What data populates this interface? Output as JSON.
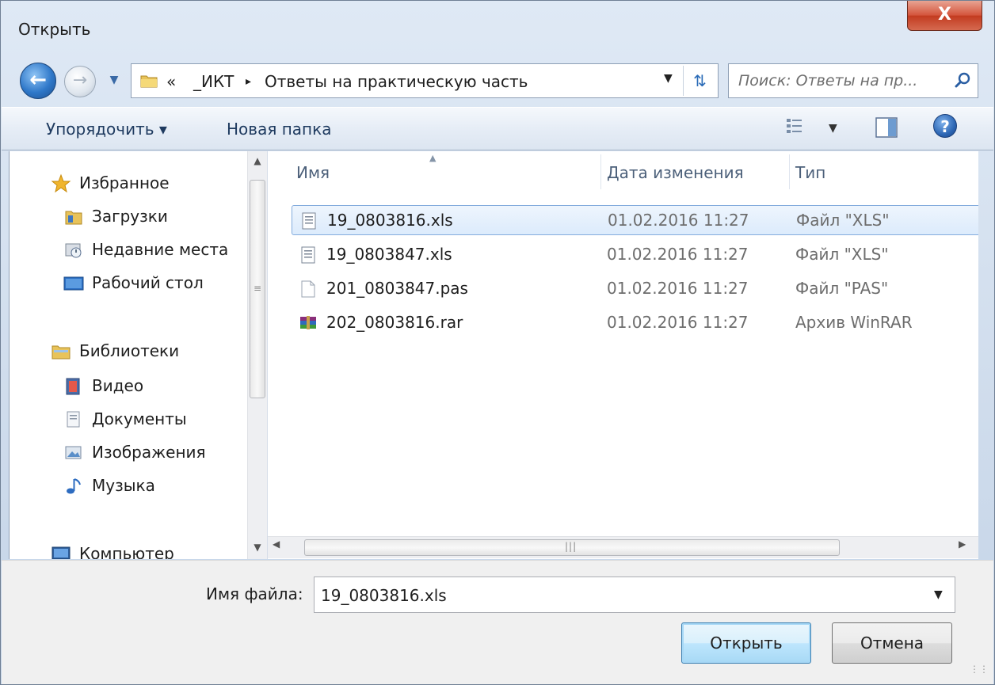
{
  "window": {
    "title": "Открыть",
    "close_label": "X"
  },
  "navigation": {
    "breadcrumb": [
      "«",
      "_ИКТ",
      "▸",
      "Ответы на практическую часть"
    ],
    "search_placeholder": "Поиск: Ответы на пр..."
  },
  "toolbar": {
    "organize_label": "Упорядочить ▾",
    "new_folder_label": "Новая папка"
  },
  "nav_pane": {
    "items": [
      {
        "label": "Избранное",
        "icon": "star-icon"
      },
      {
        "label": "Загрузки",
        "icon": "downloads-folder-icon"
      },
      {
        "label": "Недавние места",
        "icon": "recent-places-icon"
      },
      {
        "label": "Рабочий стол",
        "icon": "desktop-icon"
      },
      {
        "label": "Библиотеки",
        "icon": "libraries-icon"
      },
      {
        "label": "Видео",
        "icon": "video-icon"
      },
      {
        "label": "Документы",
        "icon": "documents-icon"
      },
      {
        "label": "Изображения",
        "icon": "pictures-icon"
      },
      {
        "label": "Музыка",
        "icon": "music-icon"
      },
      {
        "label": "Компьютер",
        "icon": "computer-icon"
      }
    ]
  },
  "file_list": {
    "columns": [
      "Имя",
      "Дата изменения",
      "Тип"
    ],
    "rows": [
      {
        "name": "19_0803816.xls",
        "date": "01.02.2016 11:27",
        "type": "Файл \"XLS\"",
        "icon": "xls-file-icon",
        "selected": true
      },
      {
        "name": "19_0803847.xls",
        "date": "01.02.2016 11:27",
        "type": "Файл \"XLS\"",
        "icon": "xls-file-icon",
        "selected": false
      },
      {
        "name": "201_0803847.pas",
        "date": "01.02.2016 11:27",
        "type": "Файл \"PAS\"",
        "icon": "blank-file-icon",
        "selected": false
      },
      {
        "name": "202_0803816.rar",
        "date": "01.02.2016 11:27",
        "type": "Архив WinRAR",
        "icon": "winrar-archive-icon",
        "selected": false
      }
    ]
  },
  "bottom": {
    "file_name_label": "Имя файла:",
    "file_name_value": "19_0803816.xls",
    "open_label": "Открыть",
    "cancel_label": "Отмена"
  },
  "colors": {
    "selection": "#dcebfc",
    "selection_border": "#84acdd",
    "accent": "#2f78c9"
  }
}
